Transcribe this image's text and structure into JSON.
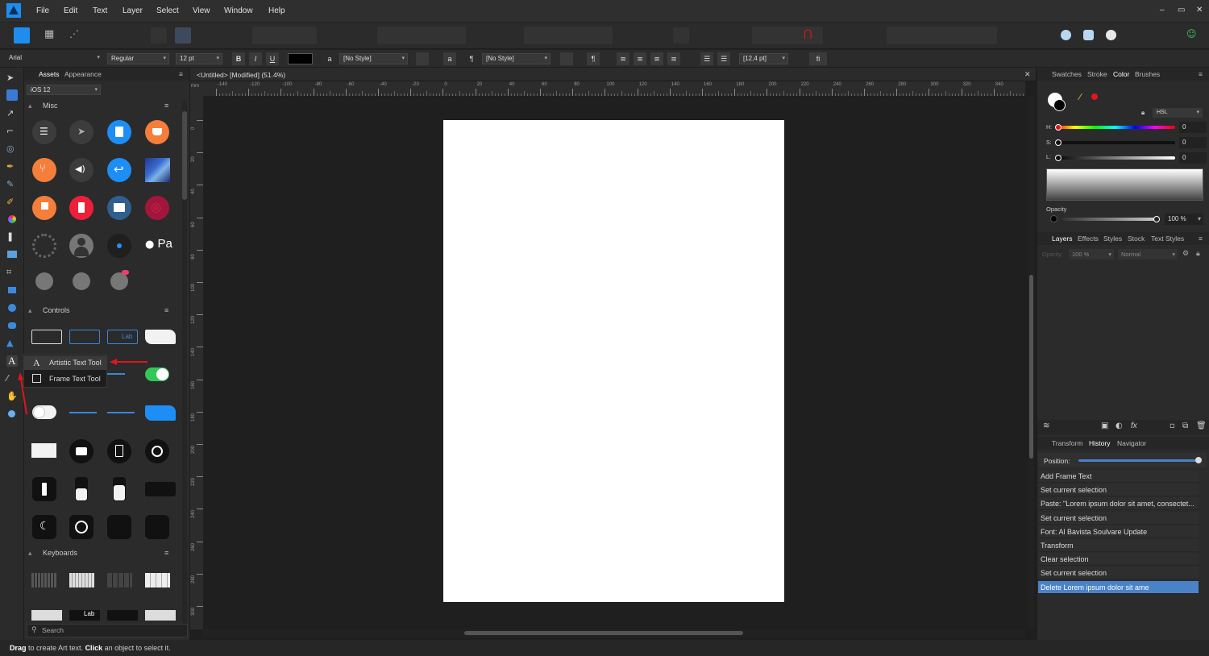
{
  "menubar": {
    "items": [
      "File",
      "Edit",
      "Text",
      "Layer",
      "Select",
      "View",
      "Window",
      "Help"
    ],
    "window_controls": [
      "–",
      "▭",
      "✕"
    ]
  },
  "context_bar": {
    "font_family": "Arial",
    "font_style": "Regular",
    "font_size": "12 pt",
    "bold": "B",
    "italic": "I",
    "underline": "U",
    "char_style": "[No Style]",
    "para_style": "[No Style]",
    "leading": "[12,4 pt]",
    "ligature": "fi",
    "pilcrow": "¶",
    "case_a": "a",
    "char_style_icon": "a"
  },
  "assets": {
    "tabs": [
      "Assets",
      "Appearance"
    ],
    "library": "iOS 12",
    "sections": [
      "Misc",
      "Controls",
      "Keyboards"
    ],
    "search_placeholder": "Search",
    "apple_pay_text": " Pa",
    "grid_label_lab": "Lab"
  },
  "tool_flyout": {
    "items": [
      "Artistic Text Tool",
      "Frame Text Tool"
    ]
  },
  "document": {
    "tab_title": "<Untitled> [Modified] (51.4%)",
    "ruler_unit": "mm",
    "h_ticks": [
      "-140",
      "-120",
      "-100",
      "-80",
      "-60",
      "-40",
      "-20",
      "0",
      "20",
      "40",
      "60",
      "80",
      "100",
      "120",
      "140",
      "160",
      "180",
      "200",
      "220",
      "240",
      "260",
      "280",
      "300",
      "320",
      "340"
    ],
    "v_ticks": [
      "0",
      "20",
      "40",
      "60",
      "80",
      "100",
      "120",
      "140",
      "160",
      "180",
      "200",
      "220",
      "240",
      "260",
      "280",
      "300"
    ]
  },
  "color_panel": {
    "tabs": [
      "Swatches",
      "Stroke",
      "Color",
      "Brushes"
    ],
    "active_tab": "Color",
    "model": "HSL",
    "h_label": "H:",
    "s_label": "S:",
    "l_label": "L:",
    "h_value": "0",
    "s_value": "0",
    "l_value": "0",
    "opacity_label": "Opacity",
    "opacity_value": "100 %"
  },
  "layers_panel": {
    "tabs": [
      "Layers",
      "Effects",
      "Styles",
      "Stock",
      "Text Styles"
    ],
    "active_tab": "Layers",
    "opacity_label": "Opacity:",
    "opacity_value": "100 %",
    "blend_mode": "Normal"
  },
  "history_panel": {
    "tabs": [
      "Transform",
      "History",
      "Navigator"
    ],
    "active_tab": "History",
    "position_label": "Position:",
    "position_fraction": 1.0,
    "items": [
      "Add Frame Text",
      "Set current selection",
      "Paste: \"Lorem ipsum dolor sit amet, consectet...",
      "Set current selection",
      "Font: Al Bavista Soulvare Update",
      "Transform",
      "Clear selection",
      "Set current selection",
      "Delete Lorem ipsum dolor sit ame"
    ],
    "selected_index": 8
  },
  "statusbar": {
    "drag": "Drag",
    "drag_text": " to create Art text. ",
    "click": "Click",
    "click_text": " an object to select it."
  },
  "colors": {
    "accent": "#4a82c8",
    "selected_history": "#4a82c8",
    "annotation_arrow": "#e0161c"
  }
}
